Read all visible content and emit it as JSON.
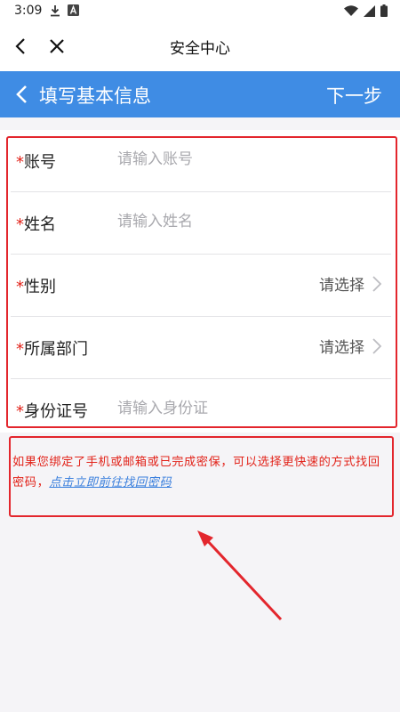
{
  "status_bar": {
    "time": "3:09",
    "icons": [
      "download-icon",
      "font-a-icon",
      "wifi-icon",
      "signal-icon",
      "battery-icon"
    ]
  },
  "top_header": {
    "title": "安全中心",
    "icons": [
      "back-icon",
      "close-icon"
    ]
  },
  "toolbar": {
    "title": "填写基本信息",
    "next_label": "下一步",
    "color": "#3f8ce4"
  },
  "form": {
    "required_mark": "*",
    "fields": [
      {
        "label": "账号",
        "placeholder": "请输入账号",
        "type": "input"
      },
      {
        "label": "姓名",
        "placeholder": "请输入姓名",
        "type": "input"
      },
      {
        "label": "性别",
        "value": "请选择",
        "type": "select"
      },
      {
        "label": "所属部门",
        "value": "请选择",
        "type": "select"
      },
      {
        "label": "身份证号",
        "placeholder": "请输入身份证",
        "type": "input"
      }
    ]
  },
  "hint": {
    "text": "如果您绑定了手机或邮箱或已完成密保，可以选择更快速的方式找回密码，",
    "link": "点击立即前往找回密码"
  },
  "colors": {
    "annotation": "#e3262d",
    "required": "#e2231a",
    "link": "#3a7fdd"
  }
}
